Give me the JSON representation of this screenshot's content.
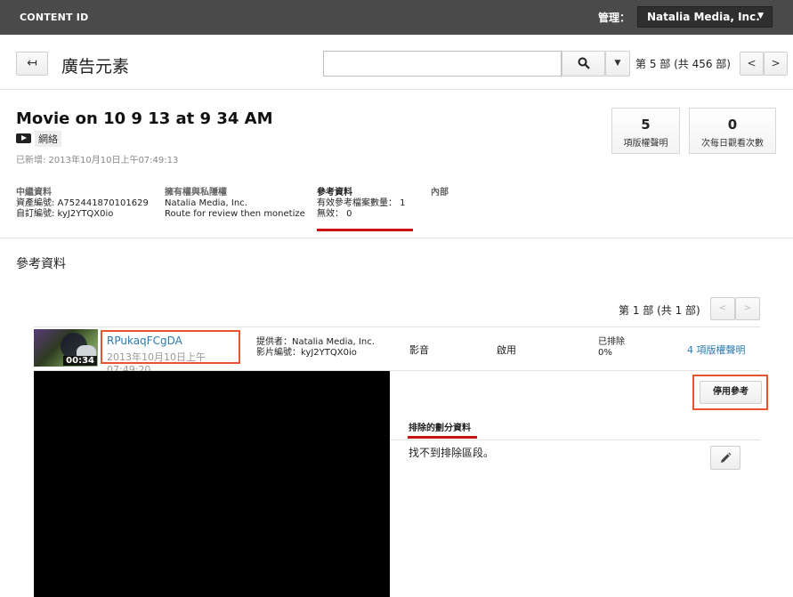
{
  "topbar": {
    "brand": "CONTENT ID",
    "manage_label": "管理：",
    "account": "Natalia Media, Inc."
  },
  "header": {
    "back_icon": "back-arrow-icon",
    "title": "廣告元素",
    "search": {
      "value": "",
      "placeholder": ""
    },
    "pager": "第 5 部 (共 456 部)",
    "prev": "<",
    "next": ">"
  },
  "asset": {
    "title": "Movie on 10 9 13 at 9 34 AM",
    "type": "網絡",
    "added": "已新增: 2013年10月10日上午07:49:13"
  },
  "stats": [
    {
      "value": "5",
      "label": "項版權聲明"
    },
    {
      "value": "0",
      "label": "次每日觀看次數"
    }
  ],
  "tabs": {
    "metadata": {
      "head": "中繼資料",
      "line1": "資產編號: A752441870101629",
      "line2": "自訂編號: kyJ2YTQX0io"
    },
    "ownership": {
      "head": "擁有權與私隱權",
      "line1": "Natalia Media, Inc.",
      "line2": "Route for review then monetize"
    },
    "references": {
      "head": "參考資料",
      "line1": "有效參考檔案數量： 1",
      "line2": "無效： 0"
    },
    "internal": {
      "head": "內部"
    }
  },
  "section_title": "參考資料",
  "ref_pager": {
    "text": "第 1 部 (共 1 部)",
    "prev": "<",
    "next": ">"
  },
  "reference": {
    "duration": "00:34",
    "id": "RPukaqFCgDA",
    "date": "2013年10月10日上午07:49:20",
    "provider": "提供者：Natalia Media, Inc.",
    "video_id": "影片編號：kyJ2YTQX0io",
    "media": "影音",
    "status": "啟用",
    "excluded_label": "已排除",
    "excluded_value": "0%",
    "claims": "4 項版權聲明"
  },
  "detail": {
    "deactivate_label": "停用參考",
    "subtab": "排除的劃分資料",
    "empty_text": "找不到排除區段。",
    "edit_icon": "pencil-icon"
  },
  "colors": {
    "topbar": "#4a4a4a",
    "link": "#2a7ab0",
    "active_tab": "#cc1111",
    "highlight": "#e8542b"
  }
}
